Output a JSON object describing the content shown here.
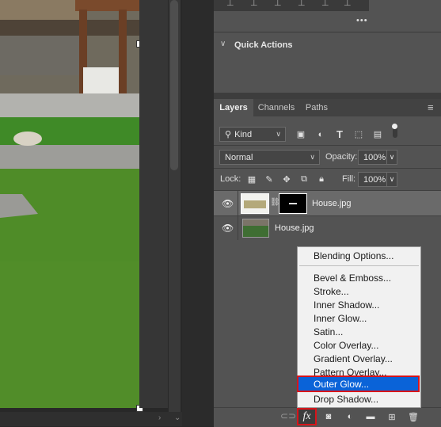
{
  "quick_actions": {
    "title": "Quick Actions",
    "more": "•••"
  },
  "tabs": [
    {
      "label": "Layers"
    },
    {
      "label": "Channels"
    },
    {
      "label": "Paths"
    }
  ],
  "filter": {
    "kind_label": "Kind"
  },
  "blend": {
    "mode": "Normal",
    "opacity_label": "Opacity:",
    "opacity": "100%"
  },
  "lock": {
    "label": "Lock:",
    "fill_label": "Fill:",
    "fill": "100%"
  },
  "layers": [
    {
      "name": "House.jpg",
      "selected": true,
      "has_mask": true
    },
    {
      "name": "House.jpg",
      "selected": false,
      "has_mask": false
    }
  ],
  "fx_menu": {
    "items": [
      "Blending Options...",
      "Bevel & Emboss...",
      "Stroke...",
      "Inner Shadow...",
      "Inner Glow...",
      "Satin...",
      "Color Overlay...",
      "Gradient Overlay...",
      "Pattern Overlay...",
      "Outer Glow...",
      "Drop Shadow..."
    ],
    "highlighted": "Outer Glow..."
  },
  "bottom_bar": {
    "fx_label": "fx"
  },
  "colors": {
    "highlight": "#0a63d8",
    "callout": "#d7141a",
    "panel": "#535353"
  }
}
